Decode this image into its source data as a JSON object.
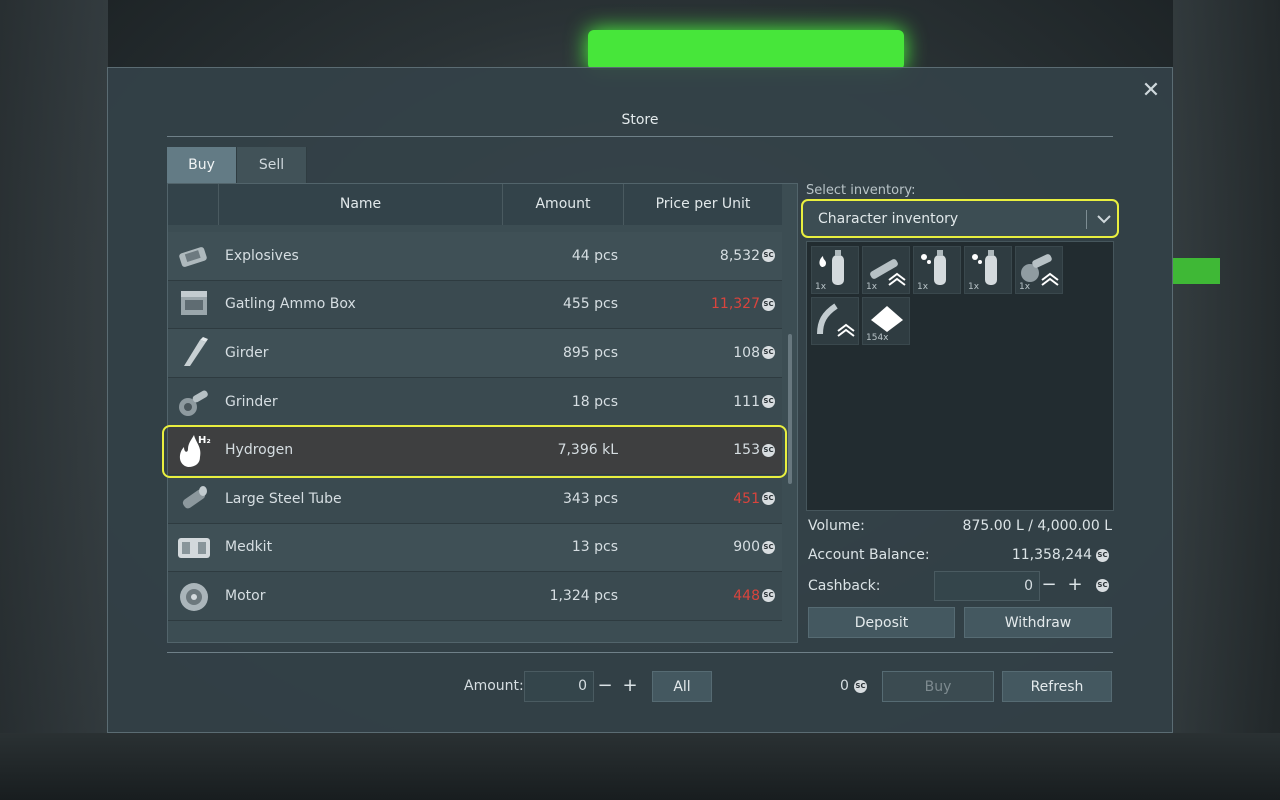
{
  "window": {
    "title": "Store",
    "close_glyph": "✕"
  },
  "tabs": [
    {
      "label": "Buy",
      "active": true
    },
    {
      "label": "Sell",
      "active": false
    }
  ],
  "table": {
    "columns": {
      "name": "Name",
      "amount": "Amount",
      "price": "Price per Unit"
    },
    "rows": [
      {
        "icon": "explosives-icon",
        "name": "Explosives",
        "amount": "44 pcs",
        "price": "8,532",
        "price_red": false
      },
      {
        "icon": "ammo-box-icon",
        "name": "Gatling Ammo Box",
        "amount": "455 pcs",
        "price": "11,327",
        "price_red": true
      },
      {
        "icon": "girder-icon",
        "name": "Girder",
        "amount": "895 pcs",
        "price": "108",
        "price_red": false
      },
      {
        "icon": "grinder-icon",
        "name": "Grinder",
        "amount": "18 pcs",
        "price": "111",
        "price_red": false
      },
      {
        "icon": "hydrogen-icon",
        "name": "Hydrogen",
        "amount": "7,396 kL",
        "price": "153",
        "price_red": false,
        "selected": true
      },
      {
        "icon": "steel-tube-icon",
        "name": "Large Steel Tube",
        "amount": "343 pcs",
        "price": "451",
        "price_red": true
      },
      {
        "icon": "medkit-icon",
        "name": "Medkit",
        "amount": "13 pcs",
        "price": "900",
        "price_red": false
      },
      {
        "icon": "motor-icon",
        "name": "Motor",
        "amount": "1,324 pcs",
        "price": "448",
        "price_red": true
      }
    ]
  },
  "currency": {
    "symbol": "SC"
  },
  "inventory": {
    "label": "Select inventory:",
    "selected": "Character inventory",
    "slots": [
      {
        "icon": "hydrogen-bottle-icon",
        "qty": "1x"
      },
      {
        "icon": "welder-tool-icon",
        "qty": "1x"
      },
      {
        "icon": "oxygen-bottle-icon",
        "qty": "1x"
      },
      {
        "icon": "oxygen-bottle-icon",
        "qty": "1x"
      },
      {
        "icon": "grinder-tool-icon",
        "qty": "1x"
      },
      {
        "icon": "drill-tool-icon",
        "qty": ""
      },
      {
        "icon": "ice-ore-icon",
        "qty": "154x"
      }
    ]
  },
  "stats": {
    "volume_label": "Volume:",
    "volume_value": "875.00 L / 4,000.00 L",
    "balance_label": "Account Balance:",
    "balance_value": "11,358,244",
    "cashback_label": "Cashback:",
    "cashback_value": "0"
  },
  "buttons": {
    "deposit": "Deposit",
    "withdraw": "Withdraw",
    "all": "All",
    "buy": "Buy",
    "refresh": "Refresh",
    "minus": "−",
    "plus": "+"
  },
  "footer": {
    "amount_label": "Amount:",
    "amount_value": "0",
    "total_value": "0"
  },
  "colors": {
    "highlight": "#e9ef3f",
    "price_warning": "#d9443d",
    "accent_green": "#47e63a"
  }
}
